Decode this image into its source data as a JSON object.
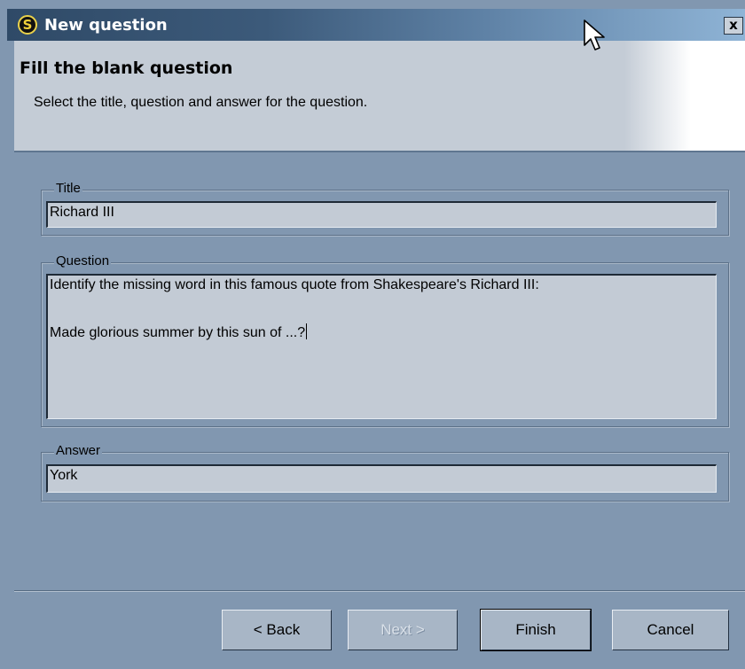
{
  "window": {
    "title": "New question",
    "app_icon_letter": "S",
    "close_glyph": "x"
  },
  "header": {
    "title": "Fill the blank question",
    "subtitle": "Select the title, question and answer for the question."
  },
  "title_group": {
    "label": "Title",
    "value": "Richard III"
  },
  "question_group": {
    "label": "Question",
    "line1": "Identify the missing word in this famous quote from Shakespeare's Richard III:",
    "line2": "Made glorious summer by this sun of ...?"
  },
  "answer_group": {
    "label": "Answer",
    "value": "York"
  },
  "buttons": {
    "back": "< Back",
    "next": "Next >",
    "finish": "Finish",
    "cancel": "Cancel"
  },
  "colors": {
    "background": "#8197b0",
    "header": "#c4ccd6",
    "field": "#c3cbd5",
    "titlebar_start": "#2f4a67",
    "titlebar_end": "#8fb4d6"
  },
  "icons": [
    "app-icon",
    "close-icon",
    "mouse-pointer-icon"
  ]
}
